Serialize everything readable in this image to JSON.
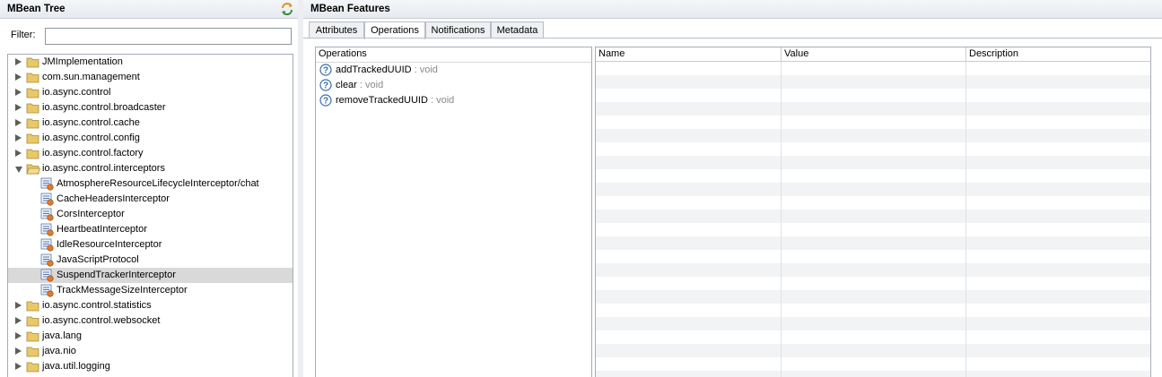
{
  "left_panel": {
    "title": "MBean Tree",
    "refresh_icon": "sync-icon",
    "filter": {
      "label": "Filter:",
      "value": "",
      "placeholder": ""
    },
    "tree": [
      {
        "label": "JMImplementation",
        "type": "folder",
        "state": "closed",
        "depth": 0
      },
      {
        "label": "com.sun.management",
        "type": "folder",
        "state": "closed",
        "depth": 0
      },
      {
        "label": "io.async.control",
        "type": "folder",
        "state": "closed",
        "depth": 0
      },
      {
        "label": "io.async.control.broadcaster",
        "type": "folder",
        "state": "closed",
        "depth": 0
      },
      {
        "label": "io.async.control.cache",
        "type": "folder",
        "state": "closed",
        "depth": 0
      },
      {
        "label": "io.async.control.config",
        "type": "folder",
        "state": "closed",
        "depth": 0
      },
      {
        "label": "io.async.control.factory",
        "type": "folder",
        "state": "closed",
        "depth": 0
      },
      {
        "label": "io.async.control.interceptors",
        "type": "folder",
        "state": "open",
        "depth": 0
      },
      {
        "label": "AtmosphereResourceLifecycleInterceptor/chat",
        "type": "mbean",
        "depth": 1
      },
      {
        "label": "CacheHeadersInterceptor",
        "type": "mbean",
        "depth": 1
      },
      {
        "label": "CorsInterceptor",
        "type": "mbean",
        "depth": 1
      },
      {
        "label": "HeartbeatInterceptor",
        "type": "mbean",
        "depth": 1
      },
      {
        "label": "IdleResourceInterceptor",
        "type": "mbean",
        "depth": 1
      },
      {
        "label": "JavaScriptProtocol",
        "type": "mbean",
        "depth": 1
      },
      {
        "label": "SuspendTrackerInterceptor",
        "type": "mbean",
        "depth": 1,
        "selected": true
      },
      {
        "label": "TrackMessageSizeInterceptor",
        "type": "mbean",
        "depth": 1
      },
      {
        "label": "io.async.control.statistics",
        "type": "folder",
        "state": "closed",
        "depth": 0
      },
      {
        "label": "io.async.control.websocket",
        "type": "folder",
        "state": "closed",
        "depth": 0
      },
      {
        "label": "java.lang",
        "type": "folder",
        "state": "closed",
        "depth": 0
      },
      {
        "label": "java.nio",
        "type": "folder",
        "state": "closed",
        "depth": 0
      },
      {
        "label": "java.util.logging",
        "type": "folder",
        "state": "closed",
        "depth": 0
      }
    ]
  },
  "right_panel": {
    "title": "MBean Features",
    "tabs": [
      {
        "label": "Attributes",
        "active": false
      },
      {
        "label": "Operations",
        "active": true
      },
      {
        "label": "Notifications",
        "active": false
      },
      {
        "label": "Metadata",
        "active": false
      }
    ],
    "operations": {
      "header": "Operations",
      "items": [
        {
          "name": "addTrackedUUID",
          "type": " : void"
        },
        {
          "name": "clear",
          "type": " : void"
        },
        {
          "name": "removeTrackedUUID",
          "type": " : void"
        }
      ]
    },
    "params_table": {
      "columns": [
        "Name",
        "Value",
        "Description"
      ],
      "rows": []
    }
  },
  "colors": {
    "folder": "#e9c86a",
    "selection": "#d9d9d9",
    "help_icon": "#3a6ea8"
  }
}
